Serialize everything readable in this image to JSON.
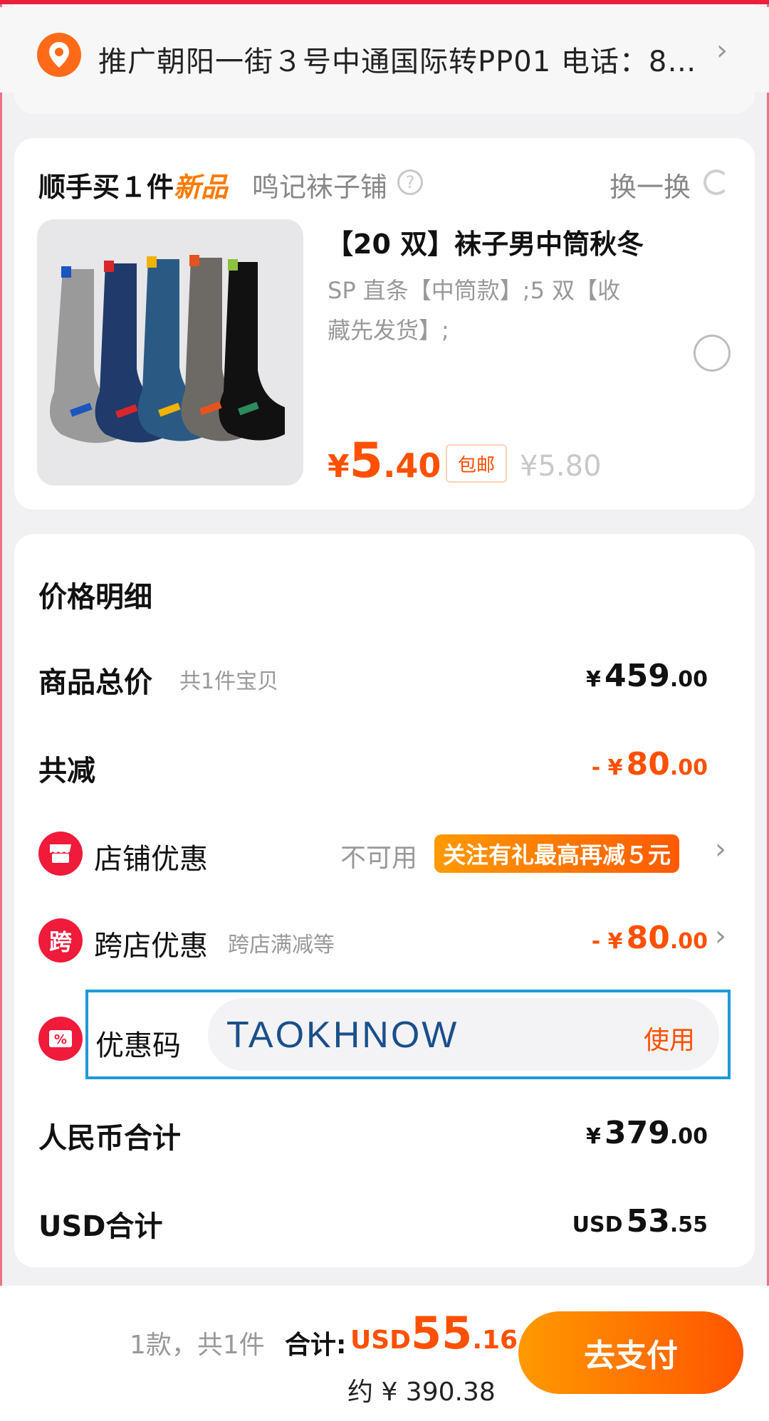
{
  "address": {
    "text": "推广朝阳一街３号中通国际转PP01 电话：8...",
    "icon": "location-pin-icon"
  },
  "recommend": {
    "title_prefix": "顺手买１件",
    "title_highlight": "新品",
    "shop": "鸣记袜子铺",
    "swap_label": "换一换",
    "product": {
      "name": "【20 双】袜子男中筒秋冬",
      "spec": "SP 直条【中筒款】;5 双【收藏先发货】;",
      "price_symbol": "¥",
      "price_int": "5",
      "price_dec": ".40",
      "free_shipping": "包邮",
      "original_price": "¥5.80"
    }
  },
  "price_detail": {
    "title": "价格明细",
    "goods_total": {
      "label": "商品总价",
      "sub": "共1件宝贝",
      "symbol": "¥",
      "int": "459",
      "dec": ".00"
    },
    "discount_total": {
      "label": "共减",
      "symbol": "- ¥",
      "int": "80",
      "dec": ".00"
    },
    "shop_coupon": {
      "label": "店铺优惠",
      "status": "不可用",
      "promo": "关注有礼最高再减５元"
    },
    "cross_shop": {
      "label": "跨店优惠",
      "sub": "跨店满减等",
      "symbol": "- ¥",
      "int": "80",
      "dec": ".00",
      "icon_text": "跨"
    },
    "coupon_code": {
      "label": "优惠码",
      "value": "TAOKHNOW",
      "use_label": "使用"
    },
    "rmb_total": {
      "label": "人民币合计",
      "symbol": "¥",
      "int": "379",
      "dec": ".00"
    },
    "usd_total": {
      "label": "USD合计",
      "symbol": "USD",
      "int": "53",
      "dec": ".55"
    }
  },
  "footer": {
    "count": "1款，共1件",
    "total_label": "合计:",
    "currency": "USD",
    "int": "55",
    "dec": ".16",
    "approx": "约 ¥ 390.38",
    "pay_button": "去支付"
  },
  "colors": {
    "accent": "#ff5000",
    "promo_orange": "#ff7a00",
    "icon_red": "#f01a3b",
    "coupon_border": "#1e9ad8"
  }
}
